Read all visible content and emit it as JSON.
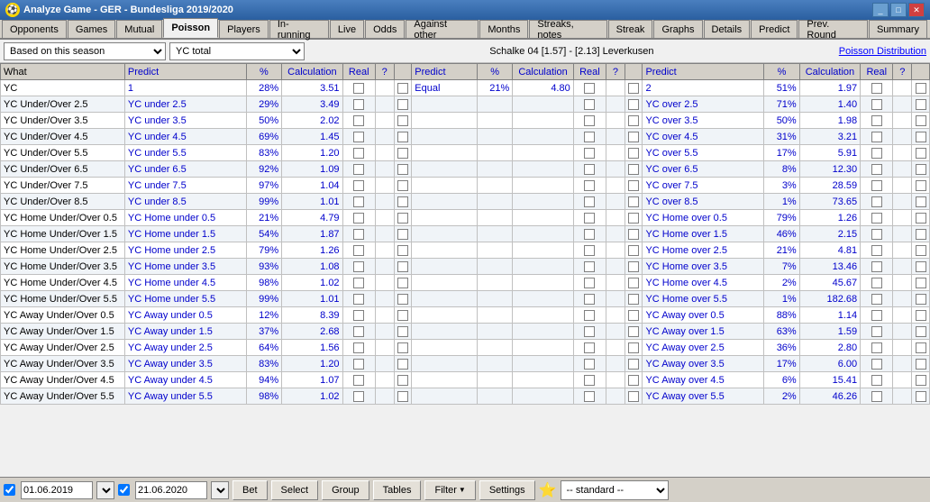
{
  "titleBar": {
    "title": "Analyze Game - GER - Bundesliga 2019/2020",
    "icon": "⚽",
    "buttons": [
      "_",
      "□",
      "✕"
    ]
  },
  "tabs": [
    {
      "label": "Opponents",
      "active": false
    },
    {
      "label": "Games",
      "active": false
    },
    {
      "label": "Mutual",
      "active": false
    },
    {
      "label": "Poisson",
      "active": true
    },
    {
      "label": "Players",
      "active": false
    },
    {
      "label": "In-running",
      "active": false
    },
    {
      "label": "Live",
      "active": false
    },
    {
      "label": "Odds",
      "active": false
    },
    {
      "label": "Against other",
      "active": false
    },
    {
      "label": "Months",
      "active": false
    },
    {
      "label": "Streaks, notes",
      "active": false
    },
    {
      "label": "Streak",
      "active": false
    },
    {
      "label": "Graphs",
      "active": false
    },
    {
      "label": "Details",
      "active": false
    },
    {
      "label": "Predict",
      "active": false
    },
    {
      "label": "Prev. Round",
      "active": false
    },
    {
      "label": "Summary",
      "active": false
    }
  ],
  "toolbar": {
    "seasonLabel": "Based on this season",
    "ycLabel": "YC total",
    "matchInfo": "Schalke 04 [1.57] - [2.13] Leverkusen",
    "poissonLink": "Poisson Distribution"
  },
  "tableHeaders": {
    "what": "What",
    "predict1": "Predict",
    "pct1": "%",
    "calc1": "Calculation",
    "real1": "Real",
    "q1": "?",
    "predict2": "Predict",
    "pct2": "%",
    "calc2": "Calculation",
    "real2": "Real",
    "q2": "?",
    "predict3": "Predict",
    "pct3": "%",
    "calc3": "Calculation",
    "real3": "Real",
    "q3": "?"
  },
  "rows": [
    {
      "what": "YC",
      "p1": "1",
      "pct1": "28%",
      "c1": "3.51",
      "p2": "Equal",
      "pct2": "21%",
      "c2": "4.80",
      "p3": "2",
      "pct3": "51%",
      "c3": "1.97"
    },
    {
      "what": "YC Under/Over 2.5",
      "p1": "YC under 2.5",
      "pct1": "29%",
      "c1": "3.49",
      "p2": "",
      "pct2": "",
      "c2": "",
      "p3": "YC over 2.5",
      "pct3": "71%",
      "c3": "1.40"
    },
    {
      "what": "YC Under/Over 3.5",
      "p1": "YC under 3.5",
      "pct1": "50%",
      "c1": "2.02",
      "p2": "",
      "pct2": "",
      "c2": "",
      "p3": "YC over 3.5",
      "pct3": "50%",
      "c3": "1.98"
    },
    {
      "what": "YC Under/Over 4.5",
      "p1": "YC under 4.5",
      "pct1": "69%",
      "c1": "1.45",
      "p2": "",
      "pct2": "",
      "c2": "",
      "p3": "YC over 4.5",
      "pct3": "31%",
      "c3": "3.21"
    },
    {
      "what": "YC Under/Over 5.5",
      "p1": "YC under 5.5",
      "pct1": "83%",
      "c1": "1.20",
      "p2": "",
      "pct2": "",
      "c2": "",
      "p3": "YC over 5.5",
      "pct3": "17%",
      "c3": "5.91"
    },
    {
      "what": "YC Under/Over 6.5",
      "p1": "YC under 6.5",
      "pct1": "92%",
      "c1": "1.09",
      "p2": "",
      "pct2": "",
      "c2": "",
      "p3": "YC over 6.5",
      "pct3": "8%",
      "c3": "12.30"
    },
    {
      "what": "YC Under/Over 7.5",
      "p1": "YC under 7.5",
      "pct1": "97%",
      "c1": "1.04",
      "p2": "",
      "pct2": "",
      "c2": "",
      "p3": "YC over 7.5",
      "pct3": "3%",
      "c3": "28.59"
    },
    {
      "what": "YC Under/Over 8.5",
      "p1": "YC under 8.5",
      "pct1": "99%",
      "c1": "1.01",
      "p2": "",
      "pct2": "",
      "c2": "",
      "p3": "YC over 8.5",
      "pct3": "1%",
      "c3": "73.65"
    },
    {
      "what": "YC Home Under/Over 0.5",
      "p1": "YC Home under 0.5",
      "pct1": "21%",
      "c1": "4.79",
      "p2": "",
      "pct2": "",
      "c2": "",
      "p3": "YC Home over 0.5",
      "pct3": "79%",
      "c3": "1.26"
    },
    {
      "what": "YC Home Under/Over 1.5",
      "p1": "YC Home under 1.5",
      "pct1": "54%",
      "c1": "1.87",
      "p2": "",
      "pct2": "",
      "c2": "",
      "p3": "YC Home over 1.5",
      "pct3": "46%",
      "c3": "2.15"
    },
    {
      "what": "YC Home Under/Over 2.5",
      "p1": "YC Home under 2.5",
      "pct1": "79%",
      "c1": "1.26",
      "p2": "",
      "pct2": "",
      "c2": "",
      "p3": "YC Home over 2.5",
      "pct3": "21%",
      "c3": "4.81"
    },
    {
      "what": "YC Home Under/Over 3.5",
      "p1": "YC Home under 3.5",
      "pct1": "93%",
      "c1": "1.08",
      "p2": "",
      "pct2": "",
      "c2": "",
      "p3": "YC Home over 3.5",
      "pct3": "7%",
      "c3": "13.46"
    },
    {
      "what": "YC Home Under/Over 4.5",
      "p1": "YC Home under 4.5",
      "pct1": "98%",
      "c1": "1.02",
      "p2": "",
      "pct2": "",
      "c2": "",
      "p3": "YC Home over 4.5",
      "pct3": "2%",
      "c3": "45.67"
    },
    {
      "what": "YC Home Under/Over 5.5",
      "p1": "YC Home under 5.5",
      "pct1": "99%",
      "c1": "1.01",
      "p2": "",
      "pct2": "",
      "c2": "",
      "p3": "YC Home over 5.5",
      "pct3": "1%",
      "c3": "182.68"
    },
    {
      "what": "YC Away Under/Over 0.5",
      "p1": "YC Away under 0.5",
      "pct1": "12%",
      "c1": "8.39",
      "p2": "",
      "pct2": "",
      "c2": "",
      "p3": "YC Away over 0.5",
      "pct3": "88%",
      "c3": "1.14"
    },
    {
      "what": "YC Away Under/Over 1.5",
      "p1": "YC Away under 1.5",
      "pct1": "37%",
      "c1": "2.68",
      "p2": "",
      "pct2": "",
      "c2": "",
      "p3": "YC Away over 1.5",
      "pct3": "63%",
      "c3": "1.59"
    },
    {
      "what": "YC Away Under/Over 2.5",
      "p1": "YC Away under 2.5",
      "pct1": "64%",
      "c1": "1.56",
      "p2": "",
      "pct2": "",
      "c2": "",
      "p3": "YC Away over 2.5",
      "pct3": "36%",
      "c3": "2.80"
    },
    {
      "what": "YC Away Under/Over 3.5",
      "p1": "YC Away under 3.5",
      "pct1": "83%",
      "c1": "1.20",
      "p2": "",
      "pct2": "",
      "c2": "",
      "p3": "YC Away over 3.5",
      "pct3": "17%",
      "c3": "6.00"
    },
    {
      "what": "YC Away Under/Over 4.5",
      "p1": "YC Away under 4.5",
      "pct1": "94%",
      "c1": "1.07",
      "p2": "",
      "pct2": "",
      "c2": "",
      "p3": "YC Away over 4.5",
      "pct3": "6%",
      "c3": "15.41"
    },
    {
      "what": "YC Away Under/Over 5.5",
      "p1": "YC Away under 5.5",
      "pct1": "98%",
      "c1": "1.02",
      "p2": "",
      "pct2": "",
      "c2": "",
      "p3": "YC Away over 5.5",
      "pct3": "2%",
      "c3": "46.26"
    }
  ],
  "bottomBar": {
    "date1": "01.06.2019",
    "date2": "21.06.2020",
    "bet": "Bet",
    "select": "Select",
    "group": "Group",
    "tables": "Tables",
    "filter": "Filter",
    "settings": "Settings",
    "standard": "-- standard --"
  }
}
